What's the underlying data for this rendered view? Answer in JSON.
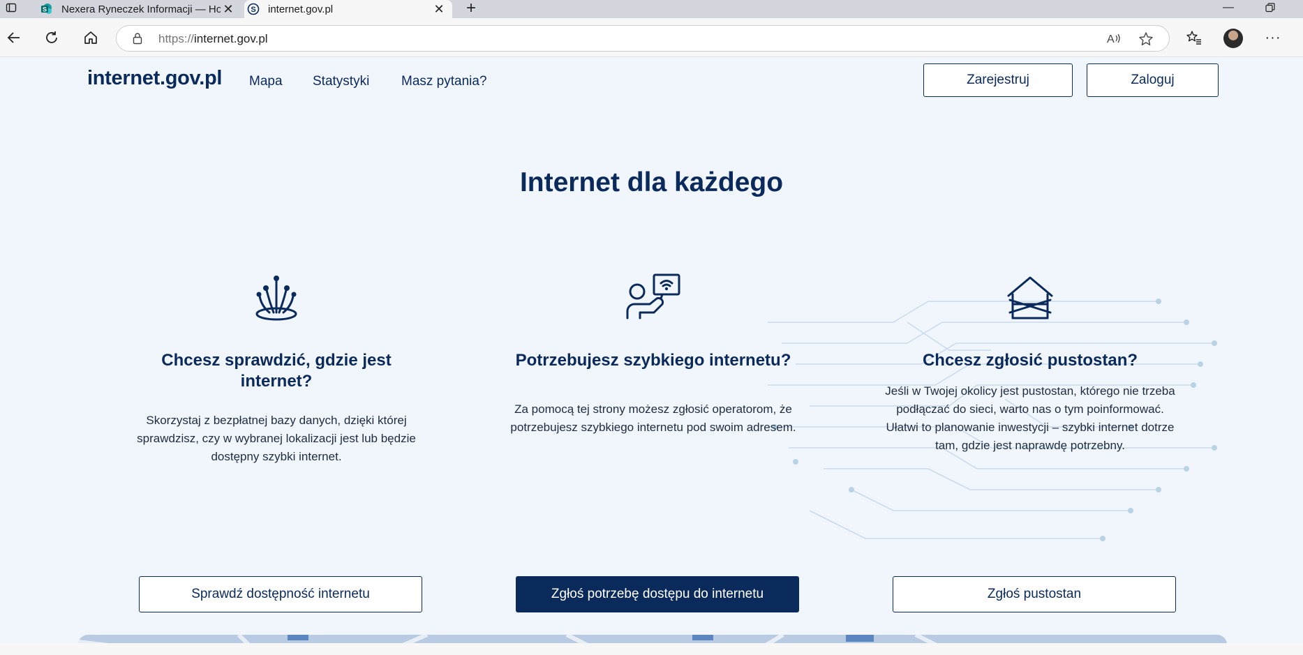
{
  "browser": {
    "tabs": [
      {
        "title": "Nexera Ryneczek Informacji — Ho",
        "active": false
      },
      {
        "title": "internet.gov.pl",
        "active": true
      }
    ],
    "url_protocol": "https://",
    "url_host": "internet.gov.pl"
  },
  "site": {
    "logo": "internet.gov.pl",
    "nav": [
      "Mapa",
      "Statystyki",
      "Masz pytania?"
    ],
    "register_label": "Zarejestruj",
    "login_label": "Zaloguj"
  },
  "hero": {
    "title": "Internet dla każdego"
  },
  "cards": [
    {
      "icon": "fiber-optic-icon",
      "title": "Chcesz sprawdzić, gdzie jest internet?",
      "text": "Skorzystaj z bezpłatnej bazy danych, dzięki której sprawdzisz, czy w wybranej lokalizacji jest lub będzie dostępny szybki internet.",
      "button": "Sprawdź dostępność internetu"
    },
    {
      "icon": "person-wifi-sign-icon",
      "title": "Potrzebujesz szybkiego internetu?",
      "text": "Za pomocą tej strony możesz zgłosić operatorom, że potrzebujesz szybkiego internetu pod swoim adresem.",
      "button": "Zgłoś potrzebę dostępu do internetu"
    },
    {
      "icon": "boarded-house-icon",
      "title": "Chcesz zgłosić pustostan?",
      "text": "Jeśli w Twojej okolicy jest pustostan, którego nie trzeba podłączać do sieci, warto nas o tym poinformować. Ułatwi to planowanie inwestycji – szybki internet dotrze tam, gdzie jest naprawdę potrzebny.",
      "button": "Zgłoś pustostan"
    }
  ],
  "colors": {
    "brand": "#0a2a5c",
    "page_bg": "#f1f5fc"
  }
}
